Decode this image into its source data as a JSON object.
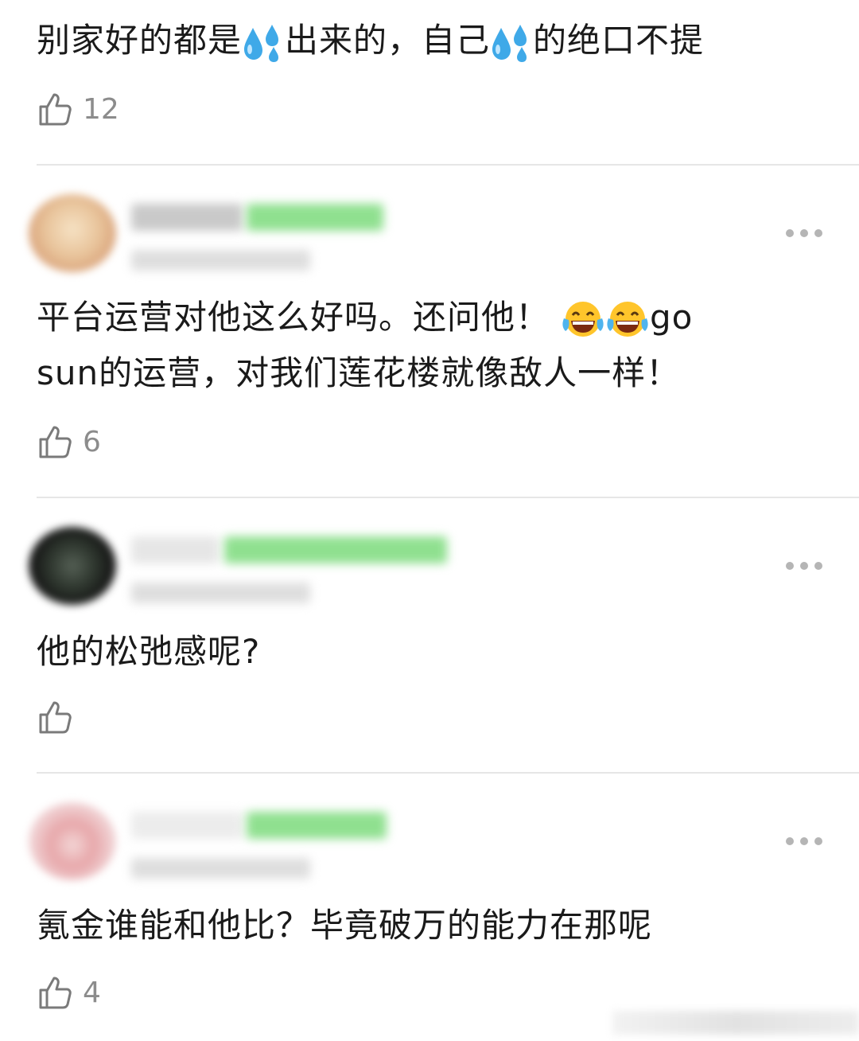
{
  "comments": [
    {
      "text_parts": [
        "别家好的都是",
        "出来的，自己",
        "的绝口不提"
      ],
      "emoji": "sweat-drops-emoji",
      "likes": "12"
    },
    {
      "line1": "平台运营对他这么好吗。还问他！",
      "line1_suffix": "go",
      "emoji": "tears-of-joy-emoji",
      "line2": "sun的运营，对我们莲花楼就像敌人一样！",
      "likes": "6"
    },
    {
      "text": "他的松弛感呢?",
      "likes": ""
    },
    {
      "text": "氪金谁能和他比？毕竟破万的能力在那呢",
      "likes": "4"
    }
  ],
  "icons": {
    "like": "thumbs-up-icon",
    "more": "more-dots-icon"
  },
  "colors": {
    "text": "#1a1a1a",
    "count": "#8c8c8c",
    "divider": "#e6e6e6",
    "emoji_drop": "#3fa9e8",
    "emoji_face": "#ffc52b"
  }
}
